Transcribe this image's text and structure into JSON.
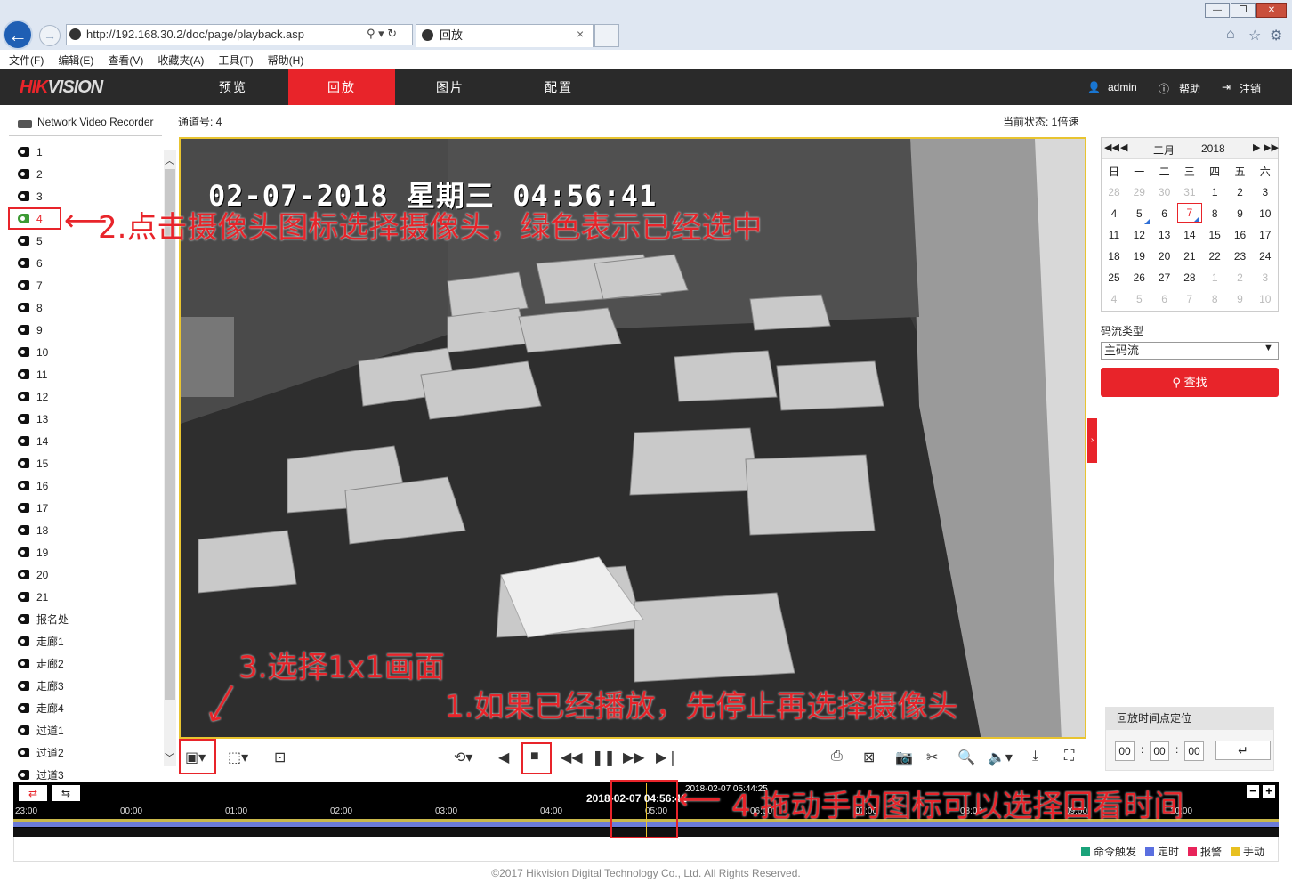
{
  "browser": {
    "url": "http://192.168.30.2/doc/page/playback.asp",
    "tab_title": "回放",
    "menu": [
      "文件(F)",
      "编辑(E)",
      "查看(V)",
      "收藏夹(A)",
      "工具(T)",
      "帮助(H)"
    ]
  },
  "app": {
    "logo_red": "HIK",
    "logo_grey": "VISION",
    "nav": [
      "预览",
      "回放",
      "图片",
      "配置"
    ],
    "active_nav": "回放",
    "user": "admin",
    "help": "帮助",
    "logout": "注销"
  },
  "sidebar": {
    "device": "Network Video Recorder",
    "channels": [
      "1",
      "2",
      "3",
      "4",
      "5",
      "6",
      "7",
      "8",
      "9",
      "10",
      "11",
      "12",
      "13",
      "14",
      "15",
      "16",
      "17",
      "18",
      "19",
      "20",
      "21",
      "报名处",
      "走廊1",
      "走廊2",
      "走廊3",
      "走廊4",
      "过道1",
      "过道2",
      "过道3"
    ],
    "selected": "4"
  },
  "main": {
    "channel_label": "通道号: 4",
    "status": "当前状态: 1倍速",
    "osd": "02-07-2018 星期三 04:56:41"
  },
  "timeline": {
    "hours": [
      "23:00",
      "00:00",
      "01:00",
      "02:00",
      "03:00",
      "04:00",
      "05:00",
      "06:00",
      "07:00",
      "08:00",
      "09:00",
      "10:00"
    ],
    "current": "2018-02-07 04:56:41",
    "marker": "2018-02-07 05:44:25",
    "legend": [
      {
        "label": "命令触发",
        "color": "#1aa37a"
      },
      {
        "label": "定时",
        "color": "#5a6fe0"
      },
      {
        "label": "报警",
        "color": "#e8245a"
      },
      {
        "label": "手动",
        "color": "#e8c020"
      }
    ]
  },
  "calendar": {
    "month": "二月",
    "year": "2018",
    "weekdays": [
      "日",
      "一",
      "二",
      "三",
      "四",
      "五",
      "六"
    ],
    "days": [
      [
        "28",
        "29",
        "30",
        "31",
        "1",
        "2",
        "3"
      ],
      [
        "4",
        "5",
        "6",
        "7",
        "8",
        "9",
        "10"
      ],
      [
        "11",
        "12",
        "13",
        "14",
        "15",
        "16",
        "17"
      ],
      [
        "18",
        "19",
        "20",
        "21",
        "22",
        "23",
        "24"
      ],
      [
        "25",
        "26",
        "27",
        "28",
        "1",
        "2",
        "3"
      ],
      [
        "4",
        "5",
        "6",
        "7",
        "8",
        "9",
        "10"
      ]
    ],
    "today": "7"
  },
  "stream": {
    "label": "码流类型",
    "value": "主码流",
    "search": "查找"
  },
  "locate": {
    "title": "回放时间点定位",
    "h": "00",
    "m": "00",
    "s": "00"
  },
  "footer": "©2017 Hikvision Digital Technology Co., Ltd. All Rights Reserved.",
  "annotations": {
    "a1": "1.如果已经播放，先停止再选择摄像头",
    "a2": "2.点击摄像头图标选择摄像头，绿色表示已经选中",
    "a3": "3.选择1x1画面",
    "a4": "4.拖动手的图标可以选择回看时间"
  }
}
